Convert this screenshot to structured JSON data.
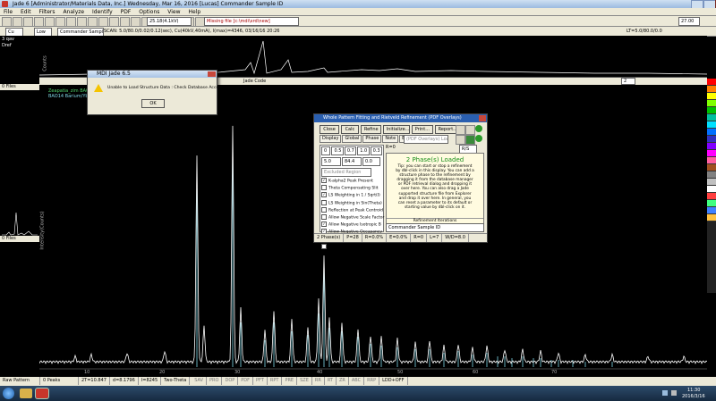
{
  "app": {
    "title": "Jade 6 [Administrator/Materials Data, Inc.] Wednesday, Mar 16, 2016 [Lucas] Commander Sample ID",
    "menu": [
      "File",
      "Edit",
      "Filters",
      "Analyze",
      "Identify",
      "PDF",
      "Options",
      "View",
      "Help"
    ]
  },
  "toolbar": {
    "element_select": "Cu",
    "mode_select": "Low",
    "sample_field": "Commander Sample ID",
    "scan_info": "SCAN: 5.0/80.0/0.02/0.12(sec), Cu(40kV,40mA), I(max)=4346, 03/16/16 20:26",
    "zoom_select": "25.18(4.1kV)",
    "pdf_status": "Missing file [c:\\mdi\\xrd\\new]",
    "right_readout": "LT=5.0/80.0/0.0",
    "right_value": "27.00"
  },
  "left_panel": {
    "items": [
      "3 qav",
      "Dref"
    ],
    "files_label": "0 Files",
    "files_label2": "0 Files"
  },
  "upper_plot": {
    "ylabel": "Counts"
  },
  "lower_plot": {
    "ylabel": "Intensity(Counts)",
    "overlay_lines": [
      "Zeapatia_zim  BA01",
      "BAO14  Barium/Yb"
    ],
    "header_label": "Jade Code",
    "spin_value": "2",
    "x_ticks": [
      "10",
      "20",
      "30",
      "40",
      "50",
      "60",
      "70"
    ]
  },
  "alert_dialog": {
    "title": "MDI Jade 6.5",
    "message": "Unable to Load Structure Data : Check Database Access!",
    "ok_label": "OK"
  },
  "wpf_dialog": {
    "title": "Whole Pattern Fitting and Rietveld Refinement (PDF Overlays)",
    "buttons": [
      "Close",
      "Calc",
      "Refine",
      "Initialize...",
      "Print...",
      "Report..."
    ],
    "tabs": [
      "Display",
      "Global",
      "Phase",
      "Note",
      "EPS"
    ],
    "pdf_select": "(PDF Overlays) Loaded",
    "row1": [
      "0",
      "0.5",
      "0.7",
      "1.0",
      "0.3"
    ],
    "row2": [
      "5.0",
      "84.4",
      "0.0"
    ],
    "region_select": "Excluded Region",
    "options": [
      {
        "label": "K-alpha2 Peak Present",
        "checked": true
      },
      {
        "label": "Theta Compensating Slit",
        "checked": false
      },
      {
        "label": "LS Weighting in 1 / Sqrt(I)",
        "checked": true
      },
      {
        "label": "LS Weighting in Sin(Theta)",
        "checked": false
      },
      {
        "label": "Reflection at Peak Centroid",
        "checked": false
      },
      {
        "label": "Allow Negative Scale Factor",
        "checked": false
      },
      {
        "label": "Allow Negative Isotropic B",
        "checked": true
      },
      {
        "label": "Allow Negative Occupancy",
        "checked": true
      },
      {
        "label": "Apply Anomalous Scattering",
        "checked": true
      },
      {
        "label": "Use Isotropic B Value Only",
        "checked": false
      }
    ],
    "r_label": "R=0",
    "r_value": "R/S",
    "loaded_heading": "2 Phase(s) Loaded",
    "tip_text": "Tip: you can start or stop a refinement by dbl-click in this display. You can add a structure phase to the refinement by dragging it from the database manager or PDF retrieval dialog and dropping it over here. You can also drag a Jade supported structure file from Explorer and drop it over here. In general, you can reset a parameter to its default or starting value by dbl-click on it.",
    "iterations_label": "Refinement Iterations",
    "sample_field": "Commander Sample ID",
    "status": [
      "2 Phase(s)",
      "P=28",
      "R=0.0%",
      "E=0.0%",
      "R=0",
      "L=7",
      "W/D=8.0"
    ]
  },
  "status_bar": {
    "items": [
      "Raw Pattern",
      "0 Peaks",
      "2T=10.847",
      "d=8.1796",
      "I=8245",
      "Two-Theta",
      "LDD+OFF"
    ],
    "buttons": [
      "SAV",
      "PRO",
      "DOP",
      "PDF",
      "PFT",
      "RPT",
      "PRE",
      "SZE",
      "RR",
      "RT",
      "ZR",
      "ABC",
      "RRP"
    ]
  },
  "taskbar": {
    "time": "11:30",
    "date": "2016/3/16"
  },
  "colors": {
    "trace": "#ffffff",
    "sticks": "#7fd6e6",
    "dialog_title": "#2a5fb0",
    "loaded_heading": "#1a8f1a"
  }
}
